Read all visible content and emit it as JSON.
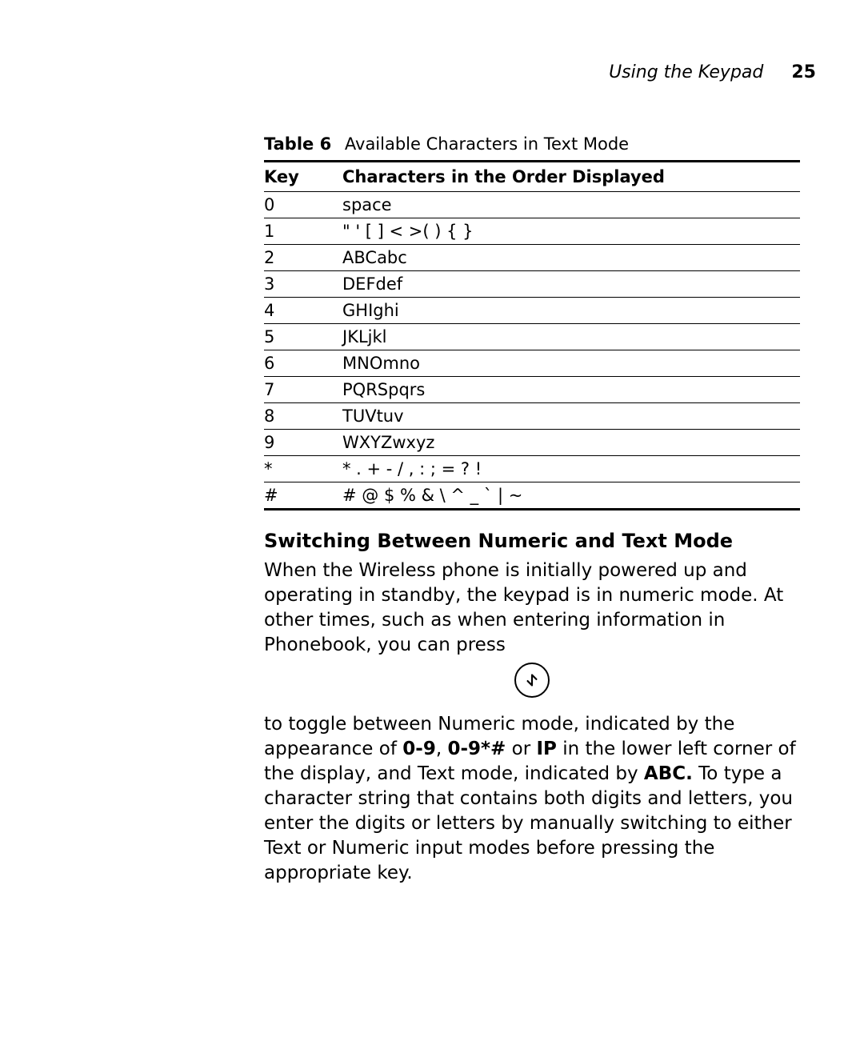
{
  "header": {
    "section": "Using the Keypad",
    "page_number": "25"
  },
  "table": {
    "caption_label": "Table 6",
    "caption_text": "Available Characters in Text Mode",
    "col_key": "Key",
    "col_chars": "Characters in the Order Displayed",
    "rows": [
      {
        "key": "0",
        "chars": "space"
      },
      {
        "key": "1",
        "chars": "\" ' [ ] < >( ) { }"
      },
      {
        "key": "2",
        "chars": "ABCabc"
      },
      {
        "key": "3",
        "chars": "DEFdef"
      },
      {
        "key": "4",
        "chars": "GHIghi"
      },
      {
        "key": "5",
        "chars": "JKLjkl"
      },
      {
        "key": "6",
        "chars": "MNOmno"
      },
      {
        "key": "7",
        "chars": "PQRSpqrs"
      },
      {
        "key": "8",
        "chars": "TUVtuv"
      },
      {
        "key": "9",
        "chars": "WXYZwxyz"
      },
      {
        "key": "*",
        "chars": "* . + - / , : ; = ? !"
      },
      {
        "key": "#",
        "chars": "# @ $ % & \\ ^ _ ` | ~"
      }
    ]
  },
  "section": {
    "heading": "Switching Between Numeric and Text Mode",
    "para1": "When the Wireless phone is initially powered up and operating in standby, the keypad is in numeric mode.  At other times, such as when entering information in Phonebook, you can press",
    "para2_a": "to toggle between Numeric mode, indicated by the appearance of ",
    "para2_b1": "0-9",
    "para2_c": ", ",
    "para2_b2": "0-9*#",
    "para2_d": " or ",
    "para2_b3": "IP",
    "para2_e": " in the lower left corner of the display, and Text mode, indicated by ",
    "para2_b4": "ABC.",
    "para2_f": " To type a character string that contains both digits and letters, you enter the digits or letters by manually switching to either Text or Numeric input modes before pressing the appropriate key."
  }
}
